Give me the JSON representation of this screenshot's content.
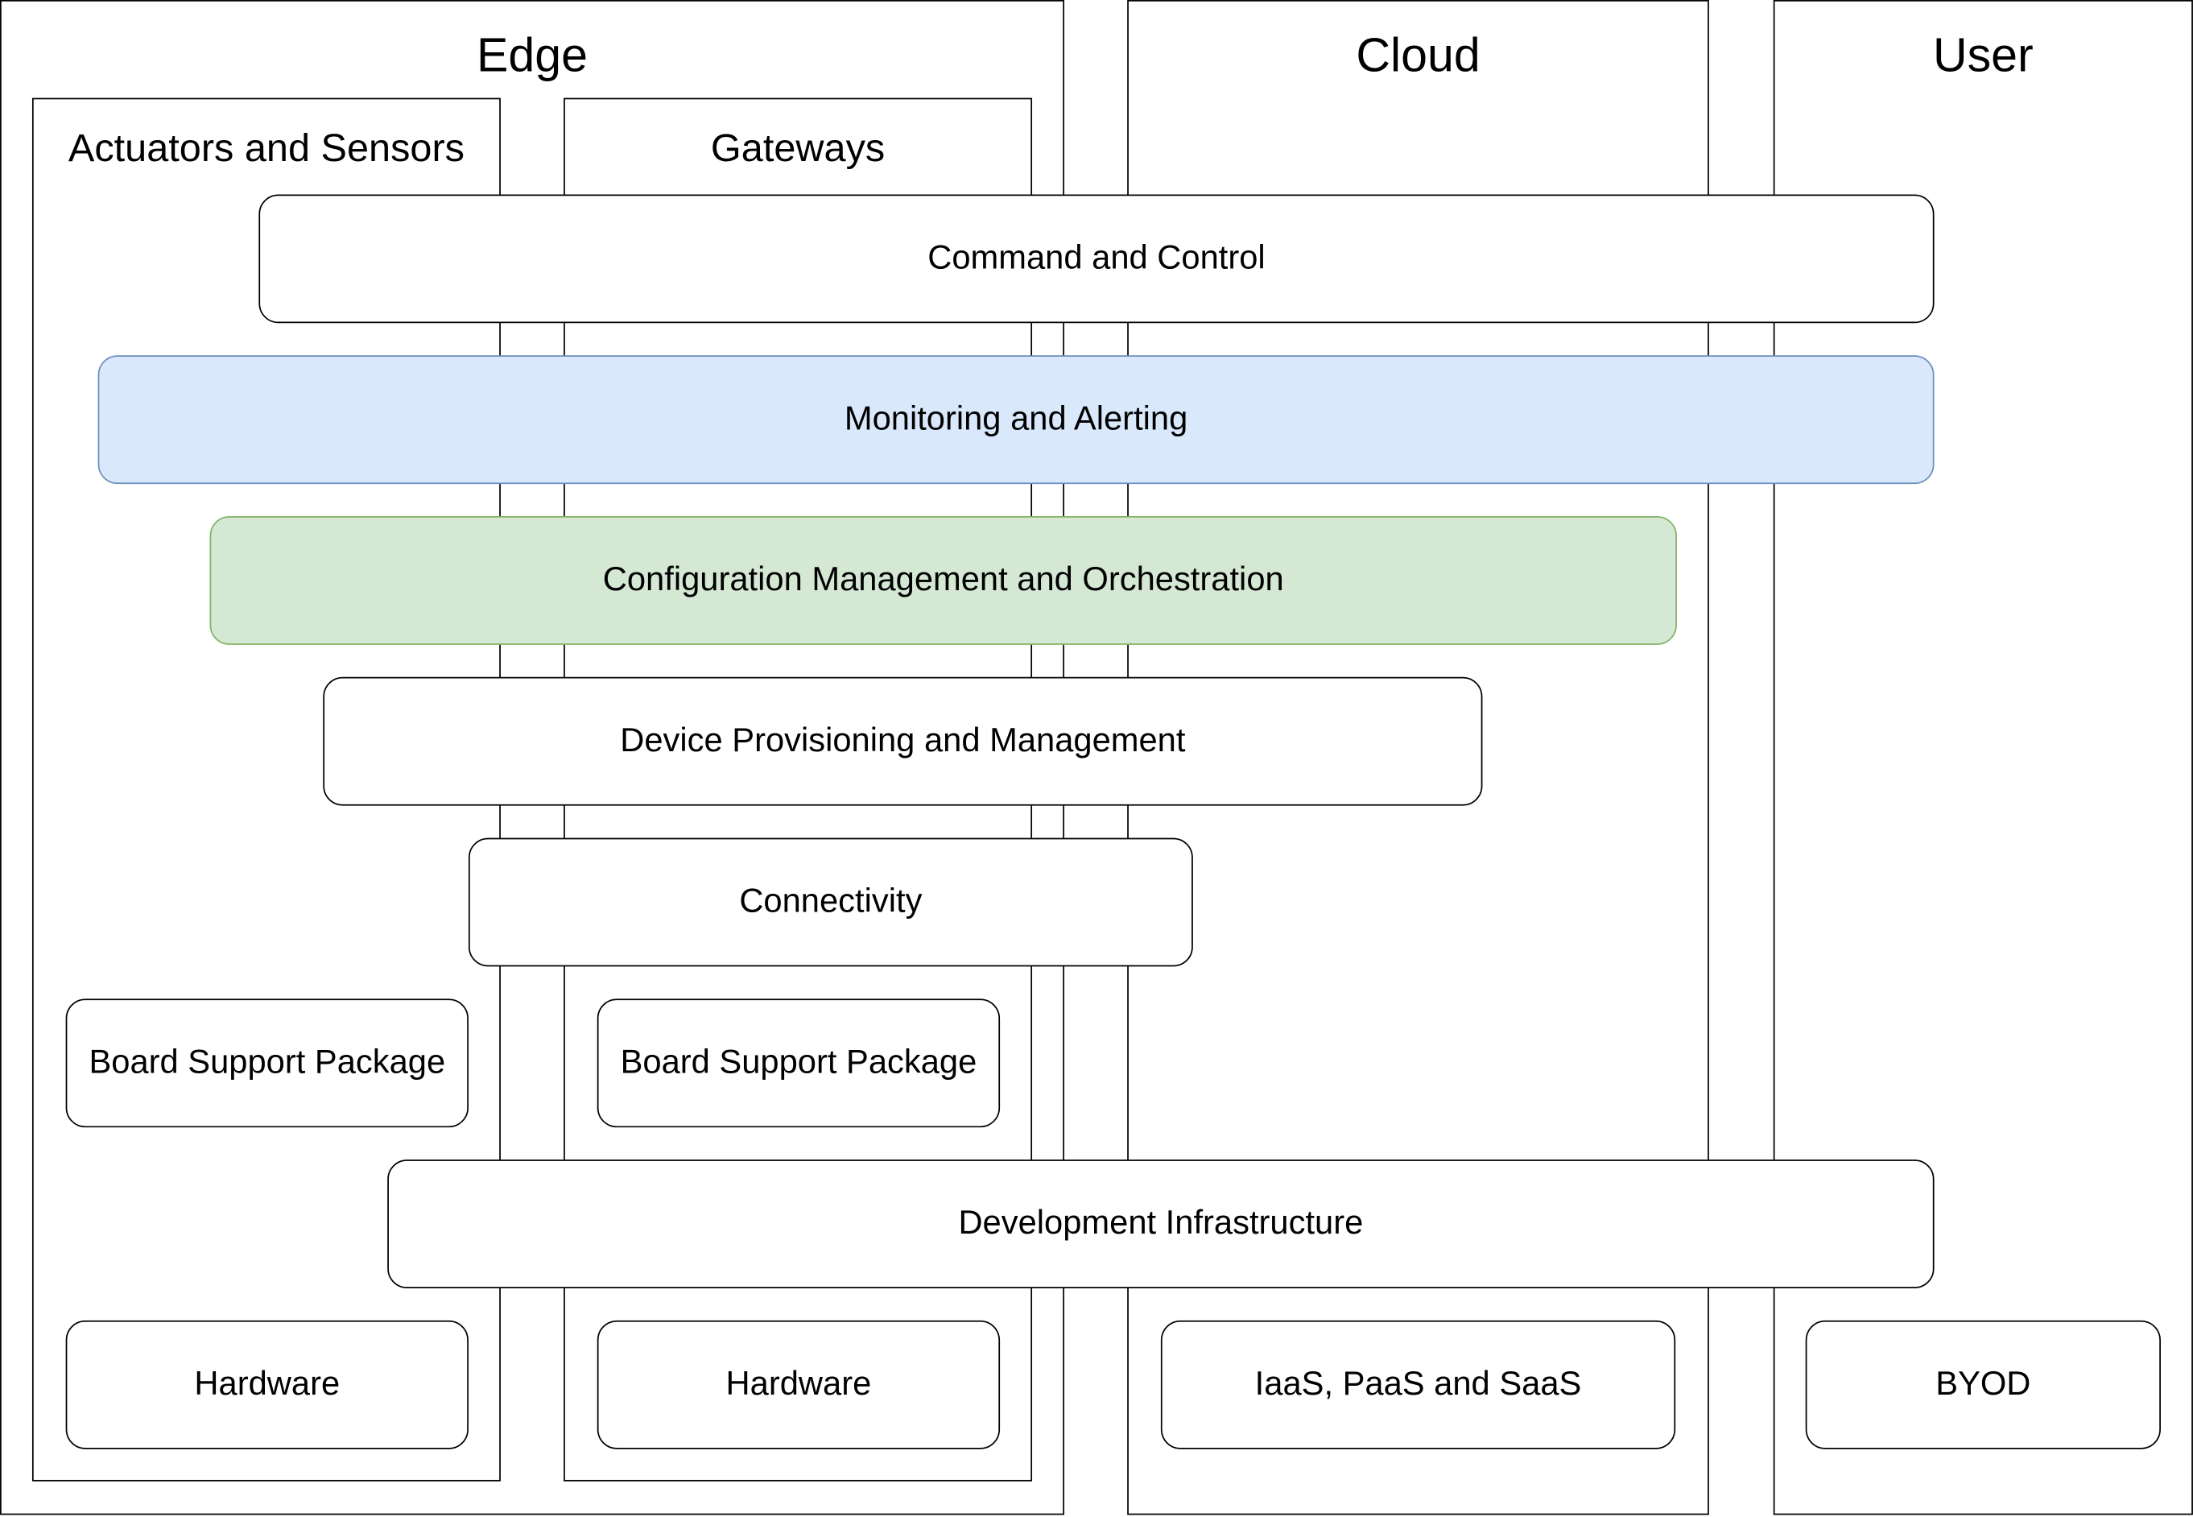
{
  "columns": {
    "edge": "Edge",
    "cloud": "Cloud",
    "user": "User",
    "actuators": "Actuators and Sensors",
    "gateways": "Gateways"
  },
  "layers": {
    "command": "Command and Control",
    "monitoring": "Monitoring and Alerting",
    "config": "Configuration Management and Orchestration",
    "device": "Device Provisioning and Management",
    "connectivity": "Connectivity",
    "bsp_actuators": "Board Support Package",
    "bsp_gateways": "Board Support Package",
    "devinfra": "Development Infrastructure",
    "hw_actuators": "Hardware",
    "hw_gateways": "Hardware",
    "cloud_base": "IaaS, PaaS and SaaS",
    "user_base": "BYOD"
  },
  "colors": {
    "monitoring_fill": "#dae8fc",
    "monitoring_stroke": "#6c8ebf",
    "config_fill": "#d5e8d4",
    "config_stroke": "#82b366"
  }
}
